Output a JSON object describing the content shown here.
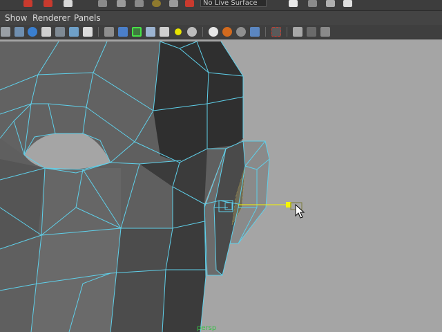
{
  "toolbar": {
    "live_surface_field": "No Live Surface"
  },
  "menu": {
    "items": [
      "Show",
      "Renderer",
      "Panels"
    ]
  },
  "viewport": {
    "camera_label": "persp",
    "wireframe_color": "#5fd0ea",
    "background_color": "#a5a5a5",
    "selection_color": "#f4f400"
  },
  "icons": {
    "top_strip": [
      "move-tool-icon",
      "rotate-tool-icon",
      "scale-tool-icon",
      "grid-snap-icon",
      "curve-snap-icon",
      "point-snap-icon",
      "make-live-icon",
      "history-icon",
      "render-icon",
      "ipr-icon",
      "render-settings-icon"
    ],
    "panel_toolbar": [
      "select-camera-icon",
      "camera-attributes-icon",
      "bookmarks-icon",
      "image-plane-icon",
      "two-d-pan-zoom-icon",
      "grease-pencil-icon",
      "grid-icon",
      "film-gate-icon",
      "resolution-gate-icon",
      "gate-mask-icon",
      "field-chart-icon",
      "safe-action-icon",
      "wireframe-icon",
      "smooth-shade-icon",
      "wireframe-on-shaded-icon",
      "textured-icon",
      "use-all-lights-icon",
      "shadows-icon",
      "screen-space-ao-icon",
      "motion-blur-icon",
      "anti-alias-icon",
      "depth-of-field-icon",
      "isolate-select-icon",
      "xray-icon",
      "xray-joints-icon",
      "xray-components-icon"
    ]
  }
}
